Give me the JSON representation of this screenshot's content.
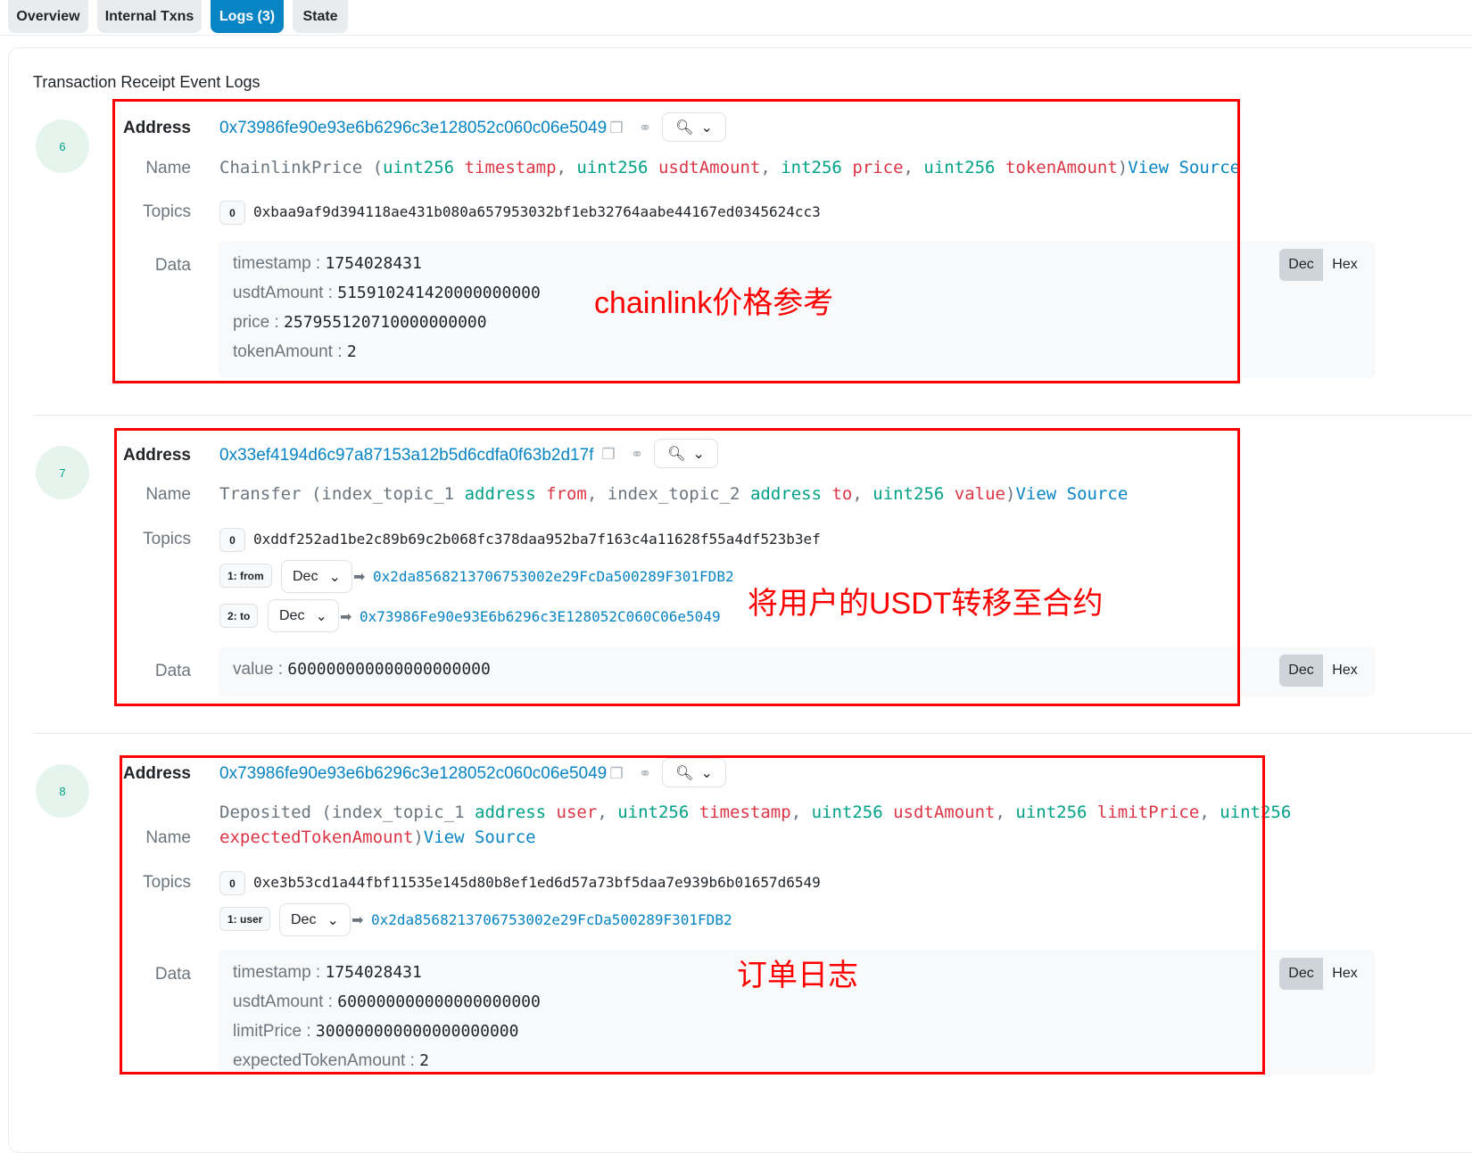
{
  "tabs": [
    {
      "label": "Overview"
    },
    {
      "label": "Internal Txns"
    },
    {
      "label": "Logs (3)"
    },
    {
      "label": "State"
    }
  ],
  "card_title": "Transaction Receipt Event Logs",
  "labels": {
    "address": "Address",
    "name": "Name",
    "topics": "Topics",
    "data": "Data",
    "dec": "Dec",
    "hex": "Hex",
    "view_source": "View Source"
  },
  "icons": {
    "copy": "copy-icon",
    "link": "link-icon",
    "zoom": "zoom-in-icon",
    "chevron": "chevron-down-icon",
    "arrow": "arrow-right-icon"
  },
  "logs": [
    {
      "index": "6",
      "address": "0x73986fe90e93e6b6296c3e128052c060c06e5049",
      "event_name": "ChainlinkPrice",
      "params": [
        {
          "type": "uint256",
          "name": "timestamp"
        },
        {
          "type": "uint256",
          "name": "usdtAmount"
        },
        {
          "type": "int256",
          "name": "price"
        },
        {
          "type": "uint256",
          "name": "tokenAmount"
        }
      ],
      "topic0": "0xbaa9af9d394118ae431b080a657953032bf1eb32764aabe44167ed0345624cc3",
      "data": [
        {
          "key": "timestamp",
          "value": "1754028431"
        },
        {
          "key": "usdtAmount",
          "value": "515910241420000000000"
        },
        {
          "key": "price",
          "value": "257955120710000000000"
        },
        {
          "key": "tokenAmount",
          "value": "2"
        }
      ],
      "annotation": "chainlink价格参考"
    },
    {
      "index": "7",
      "address": "0x33ef4194d6c97a87153a12b5d6cdfa0f63b2d17f",
      "event_name": "Transfer",
      "params": [
        {
          "prefix": "index_topic_1",
          "type": "address",
          "name": "from"
        },
        {
          "prefix": "index_topic_2",
          "type": "address",
          "name": "to"
        },
        {
          "type": "uint256",
          "name": "value"
        }
      ],
      "topic0": "0xddf252ad1be2c89b69c2b068fc378daa952ba7f163c4a11628f55a4df523b3ef",
      "topics": [
        {
          "label": "1: from",
          "format": "Dec",
          "value": "0x2da8568213706753002e29FcDa500289F301FDB2"
        },
        {
          "label": "2: to",
          "format": "Dec",
          "value": "0x73986Fe90e93E6b6296c3E128052C060C06e5049"
        }
      ],
      "data": [
        {
          "key": "value",
          "value": "600000000000000000000"
        }
      ],
      "annotation": "将用户的USDT转移至合约"
    },
    {
      "index": "8",
      "address": "0x73986fe90e93e6b6296c3e128052c060c06e5049",
      "event_name": "Deposited",
      "params": [
        {
          "prefix": "index_topic_1",
          "type": "address",
          "name": "user"
        },
        {
          "type": "uint256",
          "name": "timestamp"
        },
        {
          "type": "uint256",
          "name": "usdtAmount"
        },
        {
          "type": "uint256",
          "name": "limitPrice"
        },
        {
          "type": "uint256",
          "name": "expectedTokenAmount"
        }
      ],
      "topic0": "0xe3b53cd1a44fbf11535e145d80b8ef1ed6d57a73bf5daa7e939b6b01657d6549",
      "topics": [
        {
          "label": "1: user",
          "format": "Dec",
          "value": "0x2da8568213706753002e29FcDa500289F301FDB2"
        }
      ],
      "data": [
        {
          "key": "timestamp",
          "value": "1754028431"
        },
        {
          "key": "usdtAmount",
          "value": "600000000000000000000"
        },
        {
          "key": "limitPrice",
          "value": "300000000000000000000"
        },
        {
          "key": "expectedTokenAmount",
          "value": "2"
        }
      ],
      "annotation": "订单日志"
    }
  ]
}
